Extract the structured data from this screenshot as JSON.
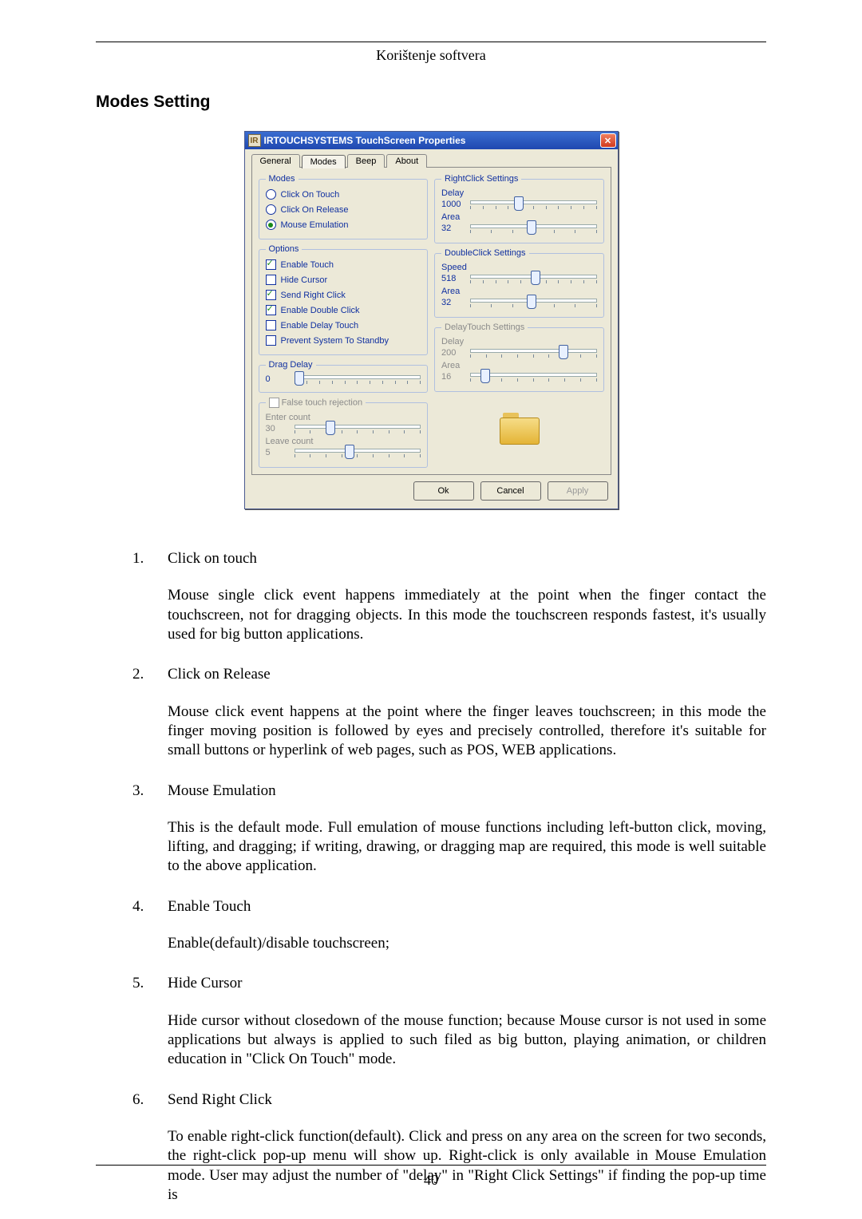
{
  "header": {
    "text": "Korištenje softvera"
  },
  "section_title": "Modes Setting",
  "window": {
    "title": "IRTOUCHSYSTEMS TouchScreen Properties",
    "icon_label": "IR",
    "tabs": {
      "general": "General",
      "modes": "Modes",
      "beep": "Beep",
      "about": "About"
    },
    "groups": {
      "modes": {
        "legend": "Modes",
        "click_on_touch": "Click On Touch",
        "click_on_release": "Click On Release",
        "mouse_emulation": "Mouse Emulation"
      },
      "options": {
        "legend": "Options",
        "enable_touch": "Enable Touch",
        "hide_cursor": "Hide Cursor",
        "send_right_click": "Send Right Click",
        "enable_double_click": "Enable Double Click",
        "enable_delay_touch": "Enable Delay Touch",
        "prevent_standby": "Prevent System To Standby"
      },
      "drag_delay": {
        "legend": "Drag Delay",
        "value": "0"
      },
      "false_touch": {
        "legend": "False touch rejection",
        "enter_label": "Enter count",
        "enter_value": "30",
        "leave_label": "Leave count",
        "leave_value": "5"
      },
      "right_click": {
        "legend": "RightClick Settings",
        "delay_label": "Delay",
        "delay_value": "1000",
        "area_label": "Area",
        "area_value": "32"
      },
      "double_click": {
        "legend": "DoubleClick Settings",
        "speed_label": "Speed",
        "speed_value": "518",
        "area_label": "Area",
        "area_value": "32"
      },
      "delay_touch": {
        "legend": "DelayTouch Settings",
        "delay_label": "Delay",
        "delay_value": "200",
        "area_label": "Area",
        "area_value": "16"
      }
    },
    "buttons": {
      "ok": "Ok",
      "cancel": "Cancel",
      "apply": "Apply"
    }
  },
  "list": [
    {
      "n": "1.",
      "title": "Click on touch",
      "desc": "Mouse single click event happens immediately at the point when the finger contact the touchscreen, not for dragging objects. In this mode the touchscreen responds fastest, it's usually used for big button applications."
    },
    {
      "n": "2.",
      "title": "Click on Release",
      "desc": "Mouse click event happens at the point where the finger leaves touchscreen; in this mode the finger moving position is followed by eyes and precisely controlled, therefore it's suitable for small buttons or hyperlink of web pages, such as POS, WEB applications."
    },
    {
      "n": "3.",
      "title": "Mouse Emulation",
      "desc": "This is the default mode. Full emulation of mouse functions including left-button click, moving, lifting, and dragging; if writing, drawing, or dragging map are required, this mode is well suitable to the above application."
    },
    {
      "n": "4.",
      "title": "Enable Touch",
      "desc": "Enable(default)/disable touchscreen;"
    },
    {
      "n": "5.",
      "title": "Hide Cursor",
      "desc": "Hide cursor without closedown of the mouse function; because Mouse cursor is not used in some applications but always is applied to such filed as big button, playing animation, or children education in \"Click On Touch\" mode."
    },
    {
      "n": "6.",
      "title": "Send Right Click",
      "desc": "To enable right-click function(default). Click and press on any area on the screen for two seconds, the right-click pop-up menu will show up. Right-click is only available in Mouse Emulation mode. User may adjust the number of \"delay\" in \"Right Click Settings\" if finding the pop-up time is"
    }
  ],
  "footer": {
    "page": "40"
  }
}
